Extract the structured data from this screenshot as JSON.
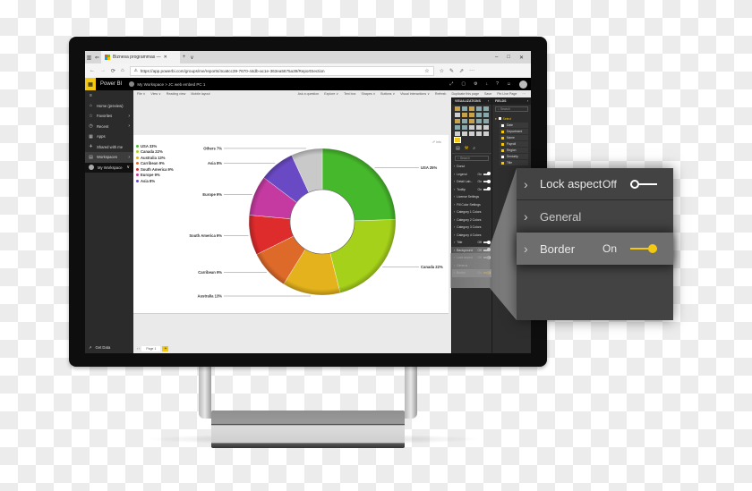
{
  "browser": {
    "tab_title": "Biznesa programmas —",
    "new_tab": "+",
    "tab_dropdown": "∨",
    "url": "https://app.powerbi.com/groups/me/reports/4ca6cc39-7670-44db-ac1e-363ea5675a39/ReportSection",
    "window_controls": [
      "–",
      "□",
      "✕"
    ],
    "toolbar_icons": [
      "☆",
      "✎",
      "⇗",
      "···"
    ]
  },
  "pbi_header": {
    "brand": "Power BI",
    "breadcrumb": "My Workspace  >  JC web embed PC 1",
    "icons": [
      "⤢",
      "▢",
      "⚙",
      "↓",
      "?",
      "☺"
    ]
  },
  "leftnav": {
    "menu_icon": "≡",
    "items": [
      {
        "label": "Home (preview)",
        "icon": "⌂",
        "chevron": ""
      },
      {
        "label": "Favorites",
        "icon": "☆",
        "chevron": "›"
      },
      {
        "label": "Recent",
        "icon": "◷",
        "chevron": "›"
      },
      {
        "label": "Apps",
        "icon": "▦",
        "chevron": ""
      },
      {
        "label": "Shared with me",
        "icon": "✈",
        "chevron": ""
      },
      {
        "label": "Workspaces",
        "icon": "▤",
        "chevron": "›"
      },
      {
        "label": "My Workspace",
        "icon": "",
        "chevron": "∨"
      }
    ],
    "get_data": "Get Data",
    "get_data_icon": "↗"
  },
  "ribbon": {
    "left": [
      "File ∨",
      "View ∨",
      "Reading view",
      "Mobile layout"
    ],
    "right": [
      "Ask a question",
      "Explore ∨",
      "Text box",
      "Shapes ∨",
      "Buttons ∨",
      "Visual interactions ∨",
      "Refresh",
      "Duplicate this page",
      "Save",
      "Pin Live Page",
      "···"
    ]
  },
  "visual": {
    "info_link": "☍ Info",
    "legend": [
      {
        "label": "USA 33%",
        "color": "#4cbf2f"
      },
      {
        "label": "Canada 22%",
        "color": "#a9d31c"
      },
      {
        "label": "Australia 13%",
        "color": "#e5b01c"
      },
      {
        "label": "Carribean 9%",
        "color": "#e06a2c"
      },
      {
        "label": "South America 9%",
        "color": "#e02c2c"
      },
      {
        "label": "Europe 9%",
        "color": "#c83aa3"
      },
      {
        "label": "Asia 8%",
        "color": "#6a4bc6"
      }
    ]
  },
  "chart_data": {
    "type": "pie",
    "style": "donut",
    "title": "",
    "legend_position": "top-left",
    "categories": [
      "USA",
      "Canada",
      "Australia",
      "Carribean",
      "South America",
      "Europe",
      "Asia",
      "Others"
    ],
    "values": [
      25,
      22,
      13,
      9,
      9,
      9,
      8,
      7
    ],
    "data_labels": [
      "USA 25%",
      "Canada 22%",
      "Australia 13%",
      "Carribean 9%",
      "South America 9%",
      "Europe 9%",
      "Asia 8%",
      "Others 7%"
    ],
    "colors": [
      "#46b82b",
      "#a6d11a",
      "#e3b21c",
      "#de6a2a",
      "#de2b2b",
      "#c53aa0",
      "#6a4ac4",
      "#c9c9c9"
    ]
  },
  "pages": {
    "nav": "‹ ›",
    "tabs": [
      "Page 1"
    ],
    "add": "+"
  },
  "viz_pane": {
    "title": "VISUALIZATIONS",
    "chevron": "›",
    "tabs": [
      "▤",
      "⚒",
      "⌕"
    ],
    "search_placeholder": "⌕ Search",
    "rows": [
      {
        "label": "Donut",
        "value": "",
        "toggle": ""
      },
      {
        "label": "Legend",
        "value": "On",
        "toggle": "on"
      },
      {
        "label": "Detail Lab...",
        "value": "On",
        "toggle": "on"
      },
      {
        "label": "Tooltip",
        "value": "On",
        "toggle": "on"
      },
      {
        "label": "License Settings",
        "value": "",
        "toggle": ""
      },
      {
        "label": "Fill Color Settings",
        "value": "",
        "toggle": ""
      },
      {
        "label": "Category 1 Colors",
        "value": "",
        "toggle": ""
      },
      {
        "label": "Category 2 Colors",
        "value": "",
        "toggle": ""
      },
      {
        "label": "Category 3 Colors",
        "value": "",
        "toggle": ""
      },
      {
        "label": "Category 4 Colors",
        "value": "",
        "toggle": ""
      },
      {
        "label": "Title",
        "value": "Off",
        "toggle": "off"
      },
      {
        "label": "Background",
        "value": "Off",
        "toggle": "off"
      },
      {
        "label": "Lock aspect",
        "value": "Off",
        "toggle": "off"
      },
      {
        "label": "General",
        "value": "",
        "toggle": ""
      },
      {
        "label": "Border",
        "value": "On",
        "toggle": "on"
      }
    ]
  },
  "fields_pane": {
    "title": "FIELDS",
    "chevron": "›",
    "search_placeholder": "⌕ Search",
    "table": "Select",
    "fields": [
      {
        "label": "Date",
        "checked": false
      },
      {
        "label": "Department",
        "checked": true
      },
      {
        "label": "Name",
        "checked": true
      },
      {
        "label": "Payroll",
        "checked": true
      },
      {
        "label": "Region",
        "checked": true
      },
      {
        "label": "Seniority",
        "checked": false
      },
      {
        "label": "Title",
        "checked": true
      }
    ]
  },
  "callout": {
    "rows": [
      {
        "label": "Lock aspect",
        "value": "Off",
        "toggle": "off"
      },
      {
        "label": "General",
        "value": "",
        "toggle": ""
      },
      {
        "label": "Border",
        "value": "On",
        "toggle": "on"
      }
    ],
    "chevron": "›"
  },
  "colors": {
    "accent": "#f2c811",
    "pane_bg": "#2e2e2e",
    "callout_bg": "#434343",
    "highlight_row": "#6e6e6e"
  }
}
